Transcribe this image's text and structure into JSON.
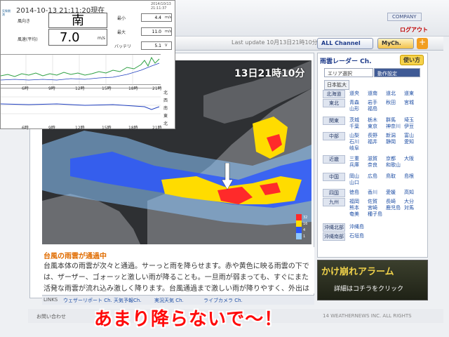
{
  "anemometer": {
    "datetime": "2014-10-13 21:11:20現在",
    "datetime_small": "2014/10/13 21:11:37",
    "logo_text": "気象観測",
    "wind_direction_label": "風向き",
    "wind_direction": "南",
    "wind_speed_label": "風速(平均)",
    "wind_speed": "7.0",
    "wind_speed_unit": "m/s",
    "stats": [
      {
        "label": "最小",
        "value": "4.4",
        "unit": "m/s"
      },
      {
        "label": "最大",
        "value": "11.0",
        "unit": "m/s"
      },
      {
        "label": "バッテリ",
        "value": "5.1",
        "unit": "V"
      }
    ],
    "hour_labels": [
      "6時",
      "9時",
      "12時",
      "15時",
      "18時",
      "21時"
    ],
    "direction_labels": [
      "北",
      "西",
      "南",
      "東",
      "北"
    ]
  },
  "site": {
    "company_label": "COMPANY",
    "logout_label": "ログアウト",
    "last_update": "Last update 10月13日21時10分 (5分更新)",
    "all_channel_label": "ALL Channel",
    "my_channel_label": "MyCh.",
    "plus_label": "+"
  },
  "radar": {
    "timestamp": "13日21時10分",
    "legend": [
      "32",
      "16",
      "4",
      "1"
    ],
    "colors": {
      "heavy": "#ff2a2a",
      "strong": "#ffdc00",
      "medium": "#2a55ff",
      "light": "#8ec8ff",
      "land": "#6a6c70",
      "sea": "#2e3033"
    }
  },
  "description": {
    "title": "台風の雨雲が通過中",
    "body": "台風本体の雨雲が次々と通過。サーっと雨を降らせます。赤や黄色に映る雨雲の下では、ザーザー、ゴォーッと激しい雨が降ることも。一旦雨が弱まっても、すぐにまた活発な雨雲が流れ込み激しく降ります。台風通過まで激しい雨が降りやすく、外出はしない方が安心"
  },
  "links": [
    "LINKS",
    "ウェザーリポート Ch.",
    "天気予報Ch.",
    "実況天気 Ch.",
    "ライブカメラ Ch."
  ],
  "footer": {
    "contact": "お問い合わせ",
    "copyright": "14 WEATHERNEWS INC. ALL RIGHTS"
  },
  "sidebar": {
    "title": "雨雲レーダー Ch.",
    "usage_button": "使い方",
    "tab_area": "エリア選択",
    "tab_movement": "動作設定",
    "japan_wide": "日本拡大",
    "regions": [
      {
        "name": "北海道",
        "prefs": [
          "道央",
          "道南",
          "道北",
          "道東"
        ]
      },
      {
        "name": "東北",
        "prefs": [
          "青森",
          "岩手",
          "秋田",
          "宮城",
          "山形",
          "福島"
        ]
      },
      {
        "name": "関東",
        "prefs": [
          "茨城",
          "栃木",
          "群馬",
          "埼玉",
          "千葉",
          "東京",
          "神奈川",
          "伊豆"
        ]
      },
      {
        "name": "中部",
        "prefs": [
          "山梨",
          "長野",
          "新潟",
          "富山",
          "石川",
          "福井",
          "静岡",
          "愛知",
          "岐阜"
        ]
      },
      {
        "name": "近畿",
        "prefs": [
          "三重",
          "滋賀",
          "京都",
          "大阪",
          "兵庫",
          "奈良",
          "和歌山"
        ]
      },
      {
        "name": "中国",
        "prefs": [
          "岡山",
          "広島",
          "鳥取",
          "島根",
          "山口"
        ]
      },
      {
        "name": "四国",
        "prefs": [
          "徳島",
          "香川",
          "愛媛",
          "高知"
        ]
      },
      {
        "name": "九州",
        "prefs": [
          "福岡",
          "佐賀",
          "長崎",
          "大分",
          "熊本",
          "宮崎",
          "鹿児島",
          "対馬",
          "奄美",
          "種子島"
        ]
      },
      {
        "name": "沖縄北部",
        "prefs": [
          "沖縄島"
        ]
      },
      {
        "name": "沖縄南部",
        "prefs": [
          "石垣島"
        ]
      }
    ]
  },
  "alarm": {
    "title": "かけ崩れアラーム",
    "subtitle": "詳細はコチラをクリック"
  },
  "caption": "あまり降らないで〜！"
}
